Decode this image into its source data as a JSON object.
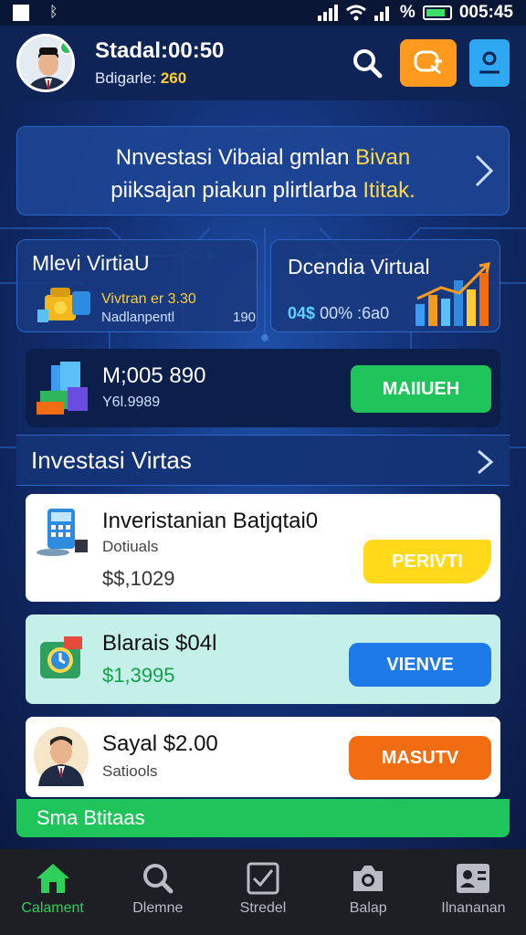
{
  "status_bar": {
    "percent": "%",
    "time": "005:45"
  },
  "header": {
    "user_name": "Stadal:00:50",
    "sub_label": "Bdigarle:",
    "coins": "260"
  },
  "banner": {
    "line1": "Nnvestasi Vibaial gmlan",
    "line1_highlight": "Bivan",
    "line2": "piiksajan piakun plirtlarba",
    "line2_highlight": "Ititak."
  },
  "card_left": {
    "title": "Mlevi VirtiaU",
    "line1": "Vivtran er 3.30",
    "line2": "Nadlanpentl",
    "line2_value": "190"
  },
  "card_right": {
    "title": "Dcendia Virtual",
    "pct_value": "04$",
    "pct_text": "00% :6a0"
  },
  "balance": {
    "amount": "M;005 890",
    "sub": "Y6l.9989",
    "button": "MAIIUEH"
  },
  "section": {
    "title": "Investasi Virtas"
  },
  "list": [
    {
      "title": "Inveristanian Batjqtai0",
      "sub": "Dotiuals",
      "price": "$$,1029",
      "button": "PERIVTI"
    },
    {
      "title": "Blarais $04l",
      "price": "$1,3995",
      "button": "VIENVE"
    },
    {
      "title": "Sayal $2.00",
      "sub": "Satiools",
      "button": "MASUTV"
    }
  ],
  "green_strip": "Sma Btitaas",
  "nav": [
    {
      "label": "Calament"
    },
    {
      "label": "Dlemne"
    },
    {
      "label": "Stredel"
    },
    {
      "label": "Balap"
    },
    {
      "label": "Ilnananan"
    }
  ],
  "colors": {
    "accent_green": "#1fc55a",
    "accent_orange": "#ff9a1f",
    "accent_blue": "#2ea8f0",
    "accent_yellow": "#ffd91a",
    "background": "#0c1a3d"
  }
}
